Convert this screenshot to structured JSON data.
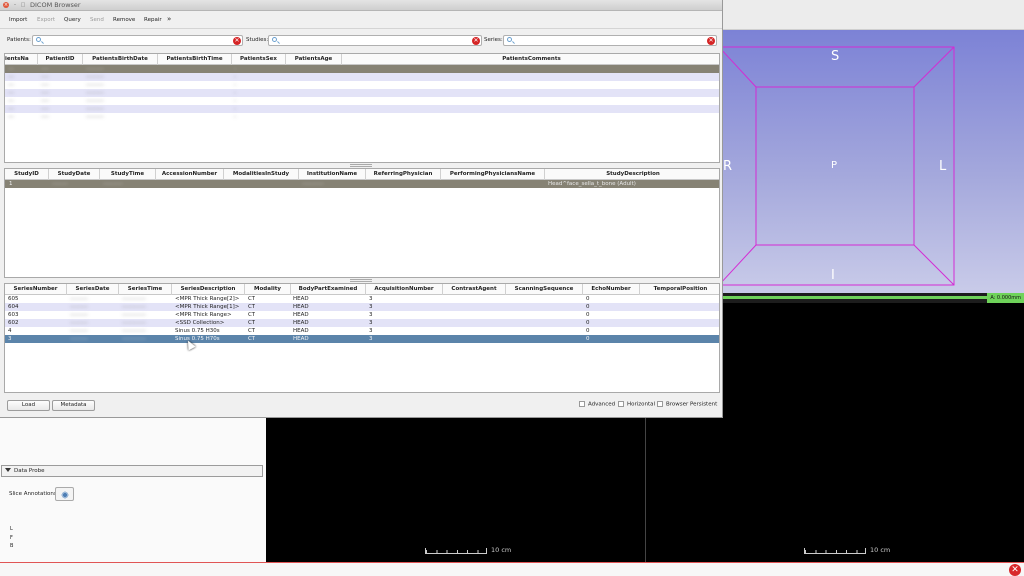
{
  "window": {
    "title": "DICOM Browser"
  },
  "toolbar": {
    "import": "Import",
    "export": "Export",
    "query": "Query",
    "send": "Send",
    "remove": "Remove",
    "repair": "Repair",
    "more": "»"
  },
  "search": {
    "patients_label": "Patients:",
    "studies_label": "Studies:",
    "series_label": "Series:"
  },
  "patients": {
    "columns": [
      "ientsNa",
      "PatientID",
      "PatientsBirthDate",
      "PatientsBirthTime",
      "PatientsSex",
      "PatientsAge",
      "PatientsComments"
    ],
    "rows": [
      [
        "---",
        "----",
        "---------",
        "-",
        "",
        "",
        ""
      ],
      [
        "---",
        "----",
        "---------",
        "-",
        "",
        "",
        ""
      ],
      [
        "---",
        "----",
        "---------",
        "-",
        "",
        "",
        ""
      ],
      [
        "---",
        "----",
        "---------",
        "-",
        "",
        "",
        ""
      ],
      [
        "---",
        "----",
        "---------",
        "-",
        "",
        "",
        ""
      ],
      [
        "---",
        "----",
        "---------",
        "-",
        "",
        "",
        ""
      ],
      [
        "---",
        "----",
        "---------",
        "-",
        "",
        "",
        ""
      ]
    ]
  },
  "studies": {
    "columns": [
      "StudyID",
      "StudyDate",
      "StudyTime",
      "AccessionNumber",
      "ModalitiesInStudy",
      "InstitutionName",
      "ReferringPhysician",
      "PerformingPhysiciansName",
      "StudyDescription"
    ],
    "rows": [
      [
        "1",
        "--------",
        "----------",
        "",
        "",
        "-----------",
        "",
        "",
        "Head^face_sella_t_bone (Adult)"
      ]
    ]
  },
  "series": {
    "columns": [
      "SeriesNumber",
      "SeriesDate",
      "SeriesTime",
      "SeriesDescription",
      "Modality",
      "BodyPartExamined",
      "AcquisitionNumber",
      "ContrastAgent",
      "ScanningSequence",
      "EchoNumber",
      "TemporalPosition"
    ],
    "rows": [
      [
        "605",
        "---------",
        "------------",
        "<MPR Thick Range[2]>",
        "CT",
        "HEAD",
        "3",
        "",
        "",
        "0",
        ""
      ],
      [
        "604",
        "---------",
        "------------",
        "<MPR Thick Range[1]>",
        "CT",
        "HEAD",
        "3",
        "",
        "",
        "0",
        ""
      ],
      [
        "603",
        "---------",
        "------------",
        "<MPR Thick Range>",
        "CT",
        "HEAD",
        "3",
        "",
        "",
        "0",
        ""
      ],
      [
        "602",
        "---------",
        "------------",
        "<SSD Collection>",
        "CT",
        "HEAD",
        "3",
        "",
        "",
        "0",
        ""
      ],
      [
        "4",
        "---------",
        "------------",
        "Sinus  0.75  H30s",
        "CT",
        "HEAD",
        "3",
        "",
        "",
        "0",
        ""
      ],
      [
        "3",
        "---------",
        "------------",
        "Sinus  0.75  H70s",
        "CT",
        "HEAD",
        "3",
        "",
        "",
        "0",
        ""
      ]
    ]
  },
  "buttons": {
    "load": "Load",
    "metadata": "Metadata"
  },
  "options": {
    "advanced": "Advanced",
    "horizontal": "Horizontal",
    "persistent": "Browser Persistent"
  },
  "view3d": {
    "superior": "S",
    "inferior": "I",
    "right": "R",
    "left": "L",
    "posterior": "P",
    "readout": "A: 0.000mm",
    "line_color": "#6fd35a",
    "box_color": "#d42bd4"
  },
  "data_probe": {
    "title": "Data Probe",
    "slice_annotations": "Slice Annotations:",
    "letters": [
      "L",
      "F",
      "B"
    ]
  },
  "rulers": {
    "left": "10 cm",
    "right": "10 cm"
  }
}
